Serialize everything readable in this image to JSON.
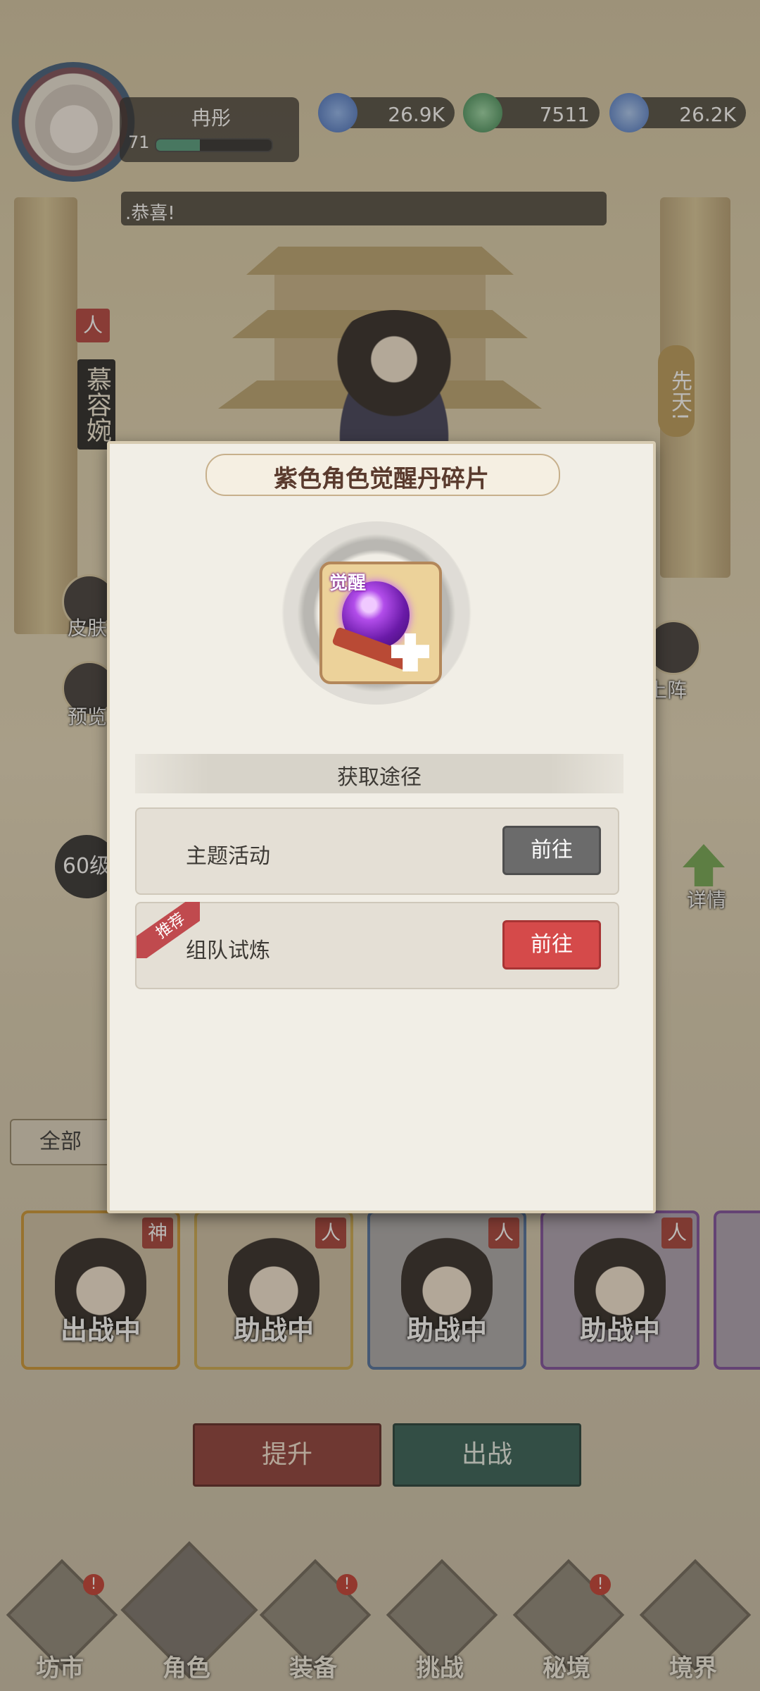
{
  "player": {
    "name": "冉彤",
    "level": "71"
  },
  "resources": [
    {
      "icon": "blue-gem-icon",
      "value": "26.9K",
      "color": "#4a7bd0"
    },
    {
      "icon": "green-jade-icon",
      "value": "7511",
      "color": "#4aa06a"
    },
    {
      "icon": "crystal-icon",
      "value": "26.2K",
      "color": "#5d8fd6"
    }
  ],
  "message": ".恭喜!",
  "hero": {
    "tag": "人",
    "name": "慕容婉",
    "trait": "先天!"
  },
  "side_buttons": {
    "skin": "皮肤",
    "preview": "预览",
    "formation": "上阵",
    "detail": "详情",
    "level_badge": "60级"
  },
  "filter": {
    "all": "全部"
  },
  "cards": [
    {
      "type": "神",
      "status": "出战中",
      "border": "#c9932e"
    },
    {
      "type": "人",
      "status": "助战中",
      "border": "#c9a64a"
    },
    {
      "type": "人",
      "status": "助战中",
      "border": "#4a6c9a"
    },
    {
      "type": "人",
      "status": "助战中",
      "border": "#7a4a9a"
    }
  ],
  "actions": {
    "upgrade": "提升",
    "deploy": "出战"
  },
  "nav": [
    {
      "label": "坊市",
      "badge": "!"
    },
    {
      "label": "角色",
      "badge": ""
    },
    {
      "label": "装备",
      "badge": "!"
    },
    {
      "label": "挑战",
      "badge": ""
    },
    {
      "label": "秘境",
      "badge": "!"
    },
    {
      "label": "境界",
      "badge": ""
    }
  ],
  "modal": {
    "title": "紫色角色觉醒丹碎片",
    "item_tag": "觉醒",
    "section_title": "获取途径",
    "sources": [
      {
        "label": "主题活动",
        "button": "前往",
        "style": "gray"
      },
      {
        "label": "组队试炼",
        "button": "前往",
        "style": "red",
        "recommend": "推荐"
      }
    ]
  }
}
